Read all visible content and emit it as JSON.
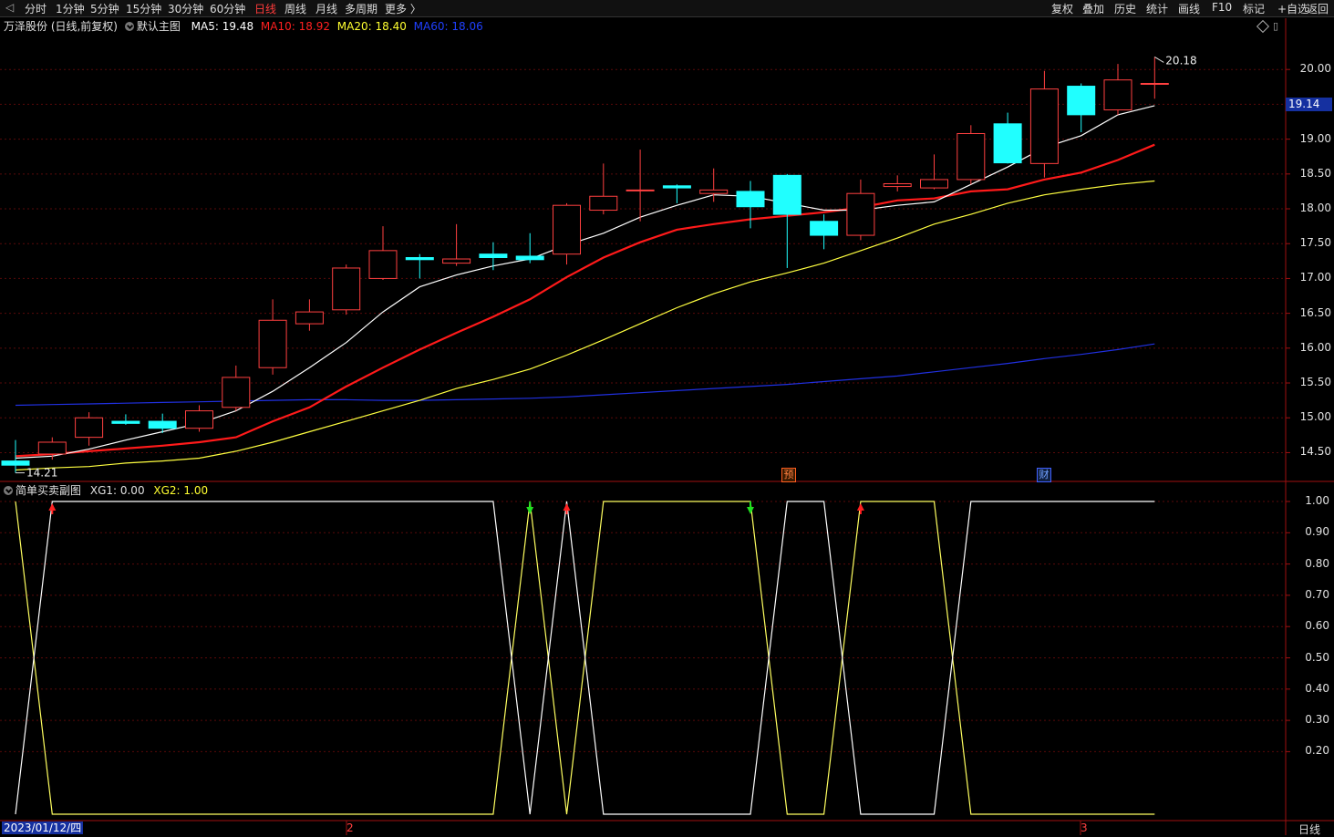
{
  "toolbar": {
    "left": [
      "分时",
      "1分钟",
      "5分钟",
      "15分钟",
      "30分钟",
      "60分钟",
      "日线",
      "周线",
      "月线",
      "多周期",
      "更多 〉"
    ],
    "active": "日线",
    "right": [
      "复权",
      "叠加",
      "历史",
      "统计",
      "画线",
      "F10",
      "标记",
      "+自选",
      "返回"
    ]
  },
  "main": {
    "stock": "万泽股份 (日线,前复权)",
    "template": "默认主图",
    "ma": [
      {
        "label": "MA5: 19.48",
        "color": "#ffffff"
      },
      {
        "label": "MA10: 18.92",
        "color": "#ff2020"
      },
      {
        "label": "MA20: 18.40",
        "color": "#ffff30"
      },
      {
        "label": "MA60: 18.06",
        "color": "#2040ff"
      }
    ],
    "high_marker": "20.18",
    "low_marker": "14.21",
    "current_price": "19.14",
    "price_labels": [
      "20.00",
      "19.50",
      "19.00",
      "18.50",
      "18.00",
      "17.50",
      "17.00",
      "16.50",
      "16.00",
      "15.50",
      "15.00",
      "14.50"
    ],
    "tag_yu": "预",
    "tag_cai": "财"
  },
  "sub": {
    "title": "简单买卖副图",
    "xg1": "XG1: 0.00",
    "xg2": "XG2: 1.00",
    "labels": [
      "1.00",
      "0.90",
      "0.80",
      "0.70",
      "0.60",
      "0.50",
      "0.40",
      "0.30",
      "0.20"
    ]
  },
  "footer": {
    "date": "2023/01/12/四",
    "month2": "2",
    "month3": "3",
    "period": "日线"
  },
  "colors": {
    "up": "#ff4040",
    "down": "#20ffff",
    "ma5": "#ffffff",
    "ma10": "#ff1a1a",
    "ma20": "#ffff40",
    "ma60": "#2030e0",
    "xg1": "#ffff60",
    "xg2": "#ffffff"
  },
  "chart_data": {
    "type": "candlestick",
    "ylim": [
      14.1,
      20.5
    ],
    "candles": [
      {
        "o": 14.38,
        "h": 14.68,
        "l": 14.21,
        "c": 14.32
      },
      {
        "o": 14.48,
        "h": 14.72,
        "l": 14.4,
        "c": 14.65
      },
      {
        "o": 14.72,
        "h": 15.08,
        "l": 14.6,
        "c": 15.0
      },
      {
        "o": 14.95,
        "h": 15.05,
        "l": 14.9,
        "c": 14.92
      },
      {
        "o": 14.95,
        "h": 15.06,
        "l": 14.78,
        "c": 14.85
      },
      {
        "o": 14.85,
        "h": 15.18,
        "l": 14.8,
        "c": 15.1
      },
      {
        "o": 15.15,
        "h": 15.75,
        "l": 15.1,
        "c": 15.58
      },
      {
        "o": 15.72,
        "h": 16.7,
        "l": 15.62,
        "c": 16.4
      },
      {
        "o": 16.35,
        "h": 16.7,
        "l": 16.25,
        "c": 16.52
      },
      {
        "o": 16.55,
        "h": 17.2,
        "l": 16.48,
        "c": 17.15
      },
      {
        "o": 17.0,
        "h": 17.75,
        "l": 16.98,
        "c": 17.4
      },
      {
        "o": 17.3,
        "h": 17.35,
        "l": 17.0,
        "c": 17.27
      },
      {
        "o": 17.22,
        "h": 17.78,
        "l": 17.18,
        "c": 17.28
      },
      {
        "o": 17.35,
        "h": 17.52,
        "l": 17.12,
        "c": 17.3
      },
      {
        "o": 17.32,
        "h": 17.65,
        "l": 17.22,
        "c": 17.27
      },
      {
        "o": 17.35,
        "h": 18.08,
        "l": 17.2,
        "c": 18.05
      },
      {
        "o": 17.98,
        "h": 18.65,
        "l": 17.92,
        "c": 18.18
      },
      {
        "o": 18.27,
        "h": 18.85,
        "l": 17.82,
        "c": 18.27
      },
      {
        "o": 18.33,
        "h": 18.35,
        "l": 18.08,
        "c": 18.3
      },
      {
        "o": 18.22,
        "h": 18.58,
        "l": 18.1,
        "c": 18.27
      },
      {
        "o": 18.25,
        "h": 18.4,
        "l": 17.72,
        "c": 18.03
      },
      {
        "o": 18.48,
        "h": 18.5,
        "l": 17.15,
        "c": 17.92
      },
      {
        "o": 17.82,
        "h": 17.92,
        "l": 17.42,
        "c": 17.62
      },
      {
        "o": 17.62,
        "h": 18.42,
        "l": 17.55,
        "c": 18.22
      },
      {
        "o": 18.32,
        "h": 18.48,
        "l": 18.25,
        "c": 18.36
      },
      {
        "o": 18.3,
        "h": 18.78,
        "l": 18.28,
        "c": 18.42
      },
      {
        "o": 18.42,
        "h": 19.2,
        "l": 18.35,
        "c": 19.08
      },
      {
        "o": 19.22,
        "h": 19.38,
        "l": 18.65,
        "c": 18.66
      },
      {
        "o": 18.65,
        "h": 19.98,
        "l": 18.45,
        "c": 19.72
      },
      {
        "o": 19.76,
        "h": 19.8,
        "l": 19.1,
        "c": 19.35
      },
      {
        "o": 19.42,
        "h": 20.08,
        "l": 19.35,
        "c": 19.85
      },
      {
        "o": 19.8,
        "h": 20.18,
        "l": 19.58,
        "c": 19.8
      }
    ],
    "ma5": [
      14.42,
      14.45,
      14.55,
      14.68,
      14.8,
      14.92,
      15.1,
      15.38,
      15.72,
      16.08,
      16.52,
      16.88,
      17.05,
      17.18,
      17.28,
      17.48,
      17.65,
      17.88,
      18.05,
      18.2,
      18.18,
      18.08,
      17.98,
      17.98,
      18.05,
      18.1,
      18.35,
      18.6,
      18.88,
      19.05,
      19.35,
      19.48
    ],
    "ma10": [
      14.45,
      14.48,
      14.52,
      14.56,
      14.6,
      14.65,
      14.72,
      14.95,
      15.15,
      15.45,
      15.72,
      15.98,
      16.22,
      16.45,
      16.7,
      17.02,
      17.3,
      17.52,
      17.7,
      17.78,
      17.85,
      17.9,
      17.95,
      18.02,
      18.12,
      18.15,
      18.25,
      18.28,
      18.42,
      18.52,
      18.7,
      18.92
    ],
    "ma20": [
      14.25,
      14.28,
      14.3,
      14.35,
      14.38,
      14.42,
      14.52,
      14.65,
      14.8,
      14.95,
      15.1,
      15.25,
      15.42,
      15.55,
      15.7,
      15.9,
      16.12,
      16.35,
      16.58,
      16.78,
      16.95,
      17.08,
      17.22,
      17.4,
      17.58,
      17.78,
      17.92,
      18.08,
      18.2,
      18.28,
      18.35,
      18.4
    ],
    "ma60": [
      15.18,
      15.19,
      15.2,
      15.21,
      15.22,
      15.23,
      15.24,
      15.25,
      15.26,
      15.26,
      15.25,
      15.25,
      15.26,
      15.27,
      15.28,
      15.3,
      15.33,
      15.36,
      15.39,
      15.42,
      15.45,
      15.48,
      15.52,
      15.56,
      15.6,
      15.66,
      15.72,
      15.78,
      15.85,
      15.91,
      15.98,
      16.06
    ],
    "xg1": [
      1,
      0,
      0,
      0,
      0,
      0,
      0,
      0,
      0,
      0,
      0,
      0,
      0,
      0,
      1,
      0,
      1,
      1,
      1,
      1,
      1,
      0,
      0,
      1,
      1,
      1,
      0,
      0,
      0,
      0,
      0,
      0
    ],
    "xg2": [
      0,
      1,
      1,
      1,
      1,
      1,
      1,
      1,
      1,
      1,
      1,
      1,
      1,
      1,
      0,
      1,
      0,
      0,
      0,
      0,
      0,
      1,
      1,
      0,
      0,
      0,
      1,
      1,
      1,
      1,
      1,
      1
    ],
    "signals": [
      {
        "i": 1,
        "type": "buy"
      },
      {
        "i": 14,
        "type": "sell"
      },
      {
        "i": 15,
        "type": "buy"
      },
      {
        "i": 20,
        "type": "sell"
      },
      {
        "i": 23,
        "type": "buy"
      }
    ]
  }
}
